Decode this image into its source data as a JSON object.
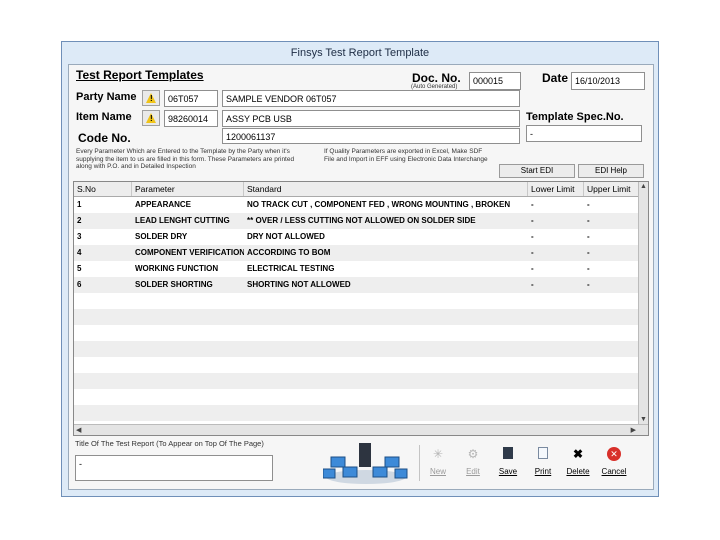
{
  "window": {
    "title": "Finsys Test Report Template"
  },
  "header": {
    "section_title": "Test Report Templates",
    "doc_no_label": "Doc. No.",
    "doc_no_value": "000015",
    "auto_generated": "(Auto Generated)",
    "date_label": "Date",
    "date_value": "16/10/2013",
    "party_label": "Party Name",
    "party_code": "06T057",
    "party_name": "SAMPLE VENDOR 06T057",
    "item_label": "Item Name",
    "item_code": "98260014",
    "item_name": "ASSY PCB USB",
    "code_label": "Code No.",
    "code_value": "1200061137",
    "template_spec_label": "Template Spec.No.",
    "template_spec_value": "-",
    "note_left": "Every Parameter Which are Entered to the Template by the Party when it's supplying the item to us are filled in this form. These Parameters are printed along with P.O. and in Detailed Inspection",
    "note_right": "If Quality Parameters are exported in Excel, Make SDF File and Import in EFF using Electronic Data Interchange",
    "start_edi_button": "Start EDI",
    "edi_help_button": "EDI Help"
  },
  "grid": {
    "columns": [
      "S.No",
      "Parameter",
      "Standard",
      "Lower Limit",
      "Upper Limit"
    ],
    "rows": [
      [
        "1",
        "APPEARANCE",
        "NO TRACK CUT , COMPONENT FED , WRONG MOUNTING , BROKEN",
        "-",
        "-"
      ],
      [
        "2",
        "LEAD LENGHT CUTTING",
        "** OVER / LESS CUTTING NOT ALLOWED ON SOLDER SIDE",
        "-",
        "-"
      ],
      [
        "3",
        "SOLDER DRY",
        "DRY NOT ALLOWED",
        "-",
        "-"
      ],
      [
        "4",
        "COMPONENT VERIFICATION",
        "ACCORDING TO BOM",
        "-",
        "-"
      ],
      [
        "5",
        "WORKING FUNCTION",
        "ELECTRICAL TESTING",
        "-",
        "-"
      ],
      [
        "6",
        "SOLDER SHORTING",
        "SHORTING NOT ALLOWED",
        "-",
        "-"
      ]
    ]
  },
  "footer": {
    "title_label": "Title Of The Test Report (To Appear on Top Of The Page)",
    "title_value": "-",
    "buttons": {
      "new": "New",
      "edit": "Edit",
      "save": "Save",
      "print": "Print",
      "delete": "Delete",
      "cancel": "Cancel"
    }
  }
}
